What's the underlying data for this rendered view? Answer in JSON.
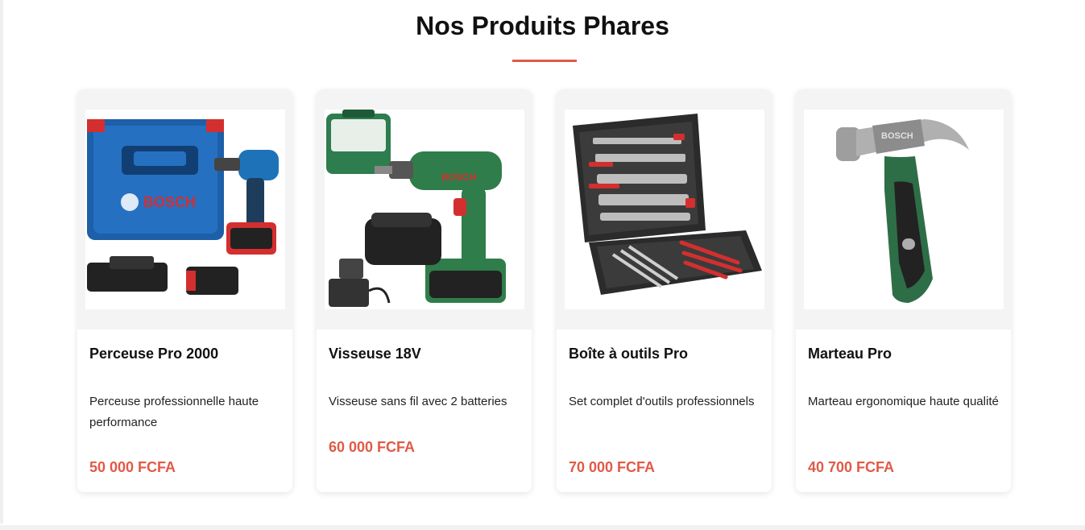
{
  "section": {
    "title": "Nos Produits Phares"
  },
  "colors": {
    "accent": "#e05a47",
    "card_media_bg": "#f4f4f4"
  },
  "products": [
    {
      "name": "Perceuse Pro 2000",
      "description": "Perceuse professionnelle haute performance",
      "price": "50 000 FCFA",
      "image_icon": "drill-kit-icon",
      "image_text": "BOSCH"
    },
    {
      "name": "Visseuse 18V",
      "description": "Visseuse sans fil avec 2 batteries",
      "price": "60 000 FCFA",
      "image_icon": "screwdriver-kit-icon",
      "image_text": "BOSCH"
    },
    {
      "name": "Boîte à outils Pro",
      "description": "Set complet d'outils professionnels",
      "price": "70 000 FCFA",
      "image_icon": "toolbox-icon",
      "image_text": ""
    },
    {
      "name": "Marteau Pro",
      "description": "Marteau ergonomique haute qualité",
      "price": "40 700 FCFA",
      "image_icon": "hammer-icon",
      "image_text": "BOSCH"
    }
  ]
}
